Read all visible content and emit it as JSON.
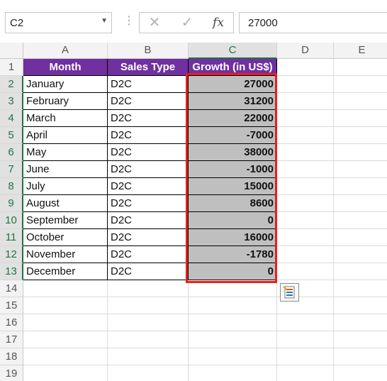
{
  "formula_bar": {
    "name_box": "C2",
    "cancel_icon": "cancel-x-icon",
    "enter_icon": "enter-check-icon",
    "fx_label": "fx",
    "formula_value": "27000"
  },
  "columns": [
    "A",
    "B",
    "C",
    "D",
    "E"
  ],
  "rows": [
    "1",
    "2",
    "3",
    "4",
    "5",
    "6",
    "7",
    "8",
    "9",
    "10",
    "11",
    "12",
    "13",
    "14",
    "15",
    "16",
    "17",
    "18",
    "19"
  ],
  "table": {
    "headers": [
      "Month",
      "Sales Type",
      "Growth (in US$)"
    ],
    "rows": [
      [
        "January",
        "D2C",
        "27000"
      ],
      [
        "February",
        "D2C",
        "31200"
      ],
      [
        "March",
        "D2C",
        "22000"
      ],
      [
        "April",
        "D2C",
        "-7000"
      ],
      [
        "May",
        "D2C",
        "38000"
      ],
      [
        "June",
        "D2C",
        "-1000"
      ],
      [
        "July",
        "D2C",
        "15000"
      ],
      [
        "August",
        "D2C",
        "8600"
      ],
      [
        "September",
        "D2C",
        "0"
      ],
      [
        "October",
        "D2C",
        "16000"
      ],
      [
        "November",
        "D2C",
        "-1780"
      ],
      [
        "December",
        "D2C",
        "0"
      ]
    ]
  },
  "colors": {
    "header_fill": "#7030a0",
    "selection_fill": "#bfbfbf",
    "highlight_border": "#e4201f",
    "excel_green": "#217346"
  },
  "quick_analysis_icon": "quick-analysis-icon"
}
